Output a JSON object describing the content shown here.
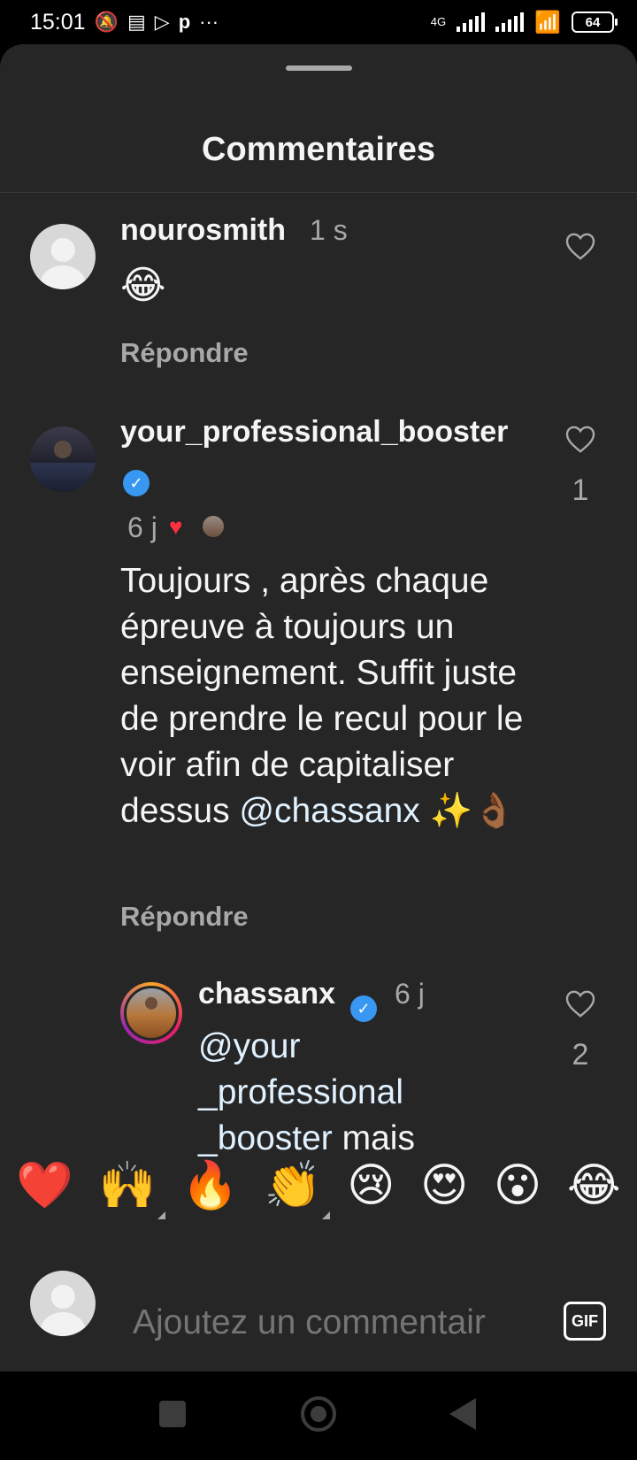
{
  "status_bar": {
    "time": "15:01",
    "network": "4G",
    "battery": "64"
  },
  "sheet": {
    "title": "Commentaires"
  },
  "comments": [
    {
      "username": "nourosmith",
      "time": "1 s",
      "text": "😂",
      "reply_label": "Répondre",
      "likes": ""
    },
    {
      "username": "your_professional_booster",
      "verified": true,
      "time": "6 j",
      "text": "Toujours , après chaque épreuve à toujours un enseignement. Suffit juste de prendre le recul pour le voir afin de capitaliser dessus",
      "mention": "@chassanx",
      "emojis": "✨👌🏾",
      "reply_label": "Répondre",
      "likes": "1"
    }
  ],
  "reply": {
    "username": "chassanx",
    "verified": true,
    "time": "6 j",
    "mention_line1": "@your",
    "mention_line2": "_professional",
    "mention_line3": "_booster",
    "text_tail": "mais",
    "likes": "2"
  },
  "quick_reactions": [
    "❤️",
    "🙌",
    "🔥",
    "👏",
    "😢",
    "😍",
    "😮",
    "😂"
  ],
  "composer": {
    "placeholder": "Ajoutez un commentair",
    "gif_label": "GIF"
  },
  "icons": {
    "like": "heart-outline-icon",
    "liked_by_author": "heart-filled-icon"
  },
  "colors": {
    "background": "#262626",
    "verified": "#3897f0",
    "heart": "#ff3040",
    "muted": "#a8a8a8"
  }
}
